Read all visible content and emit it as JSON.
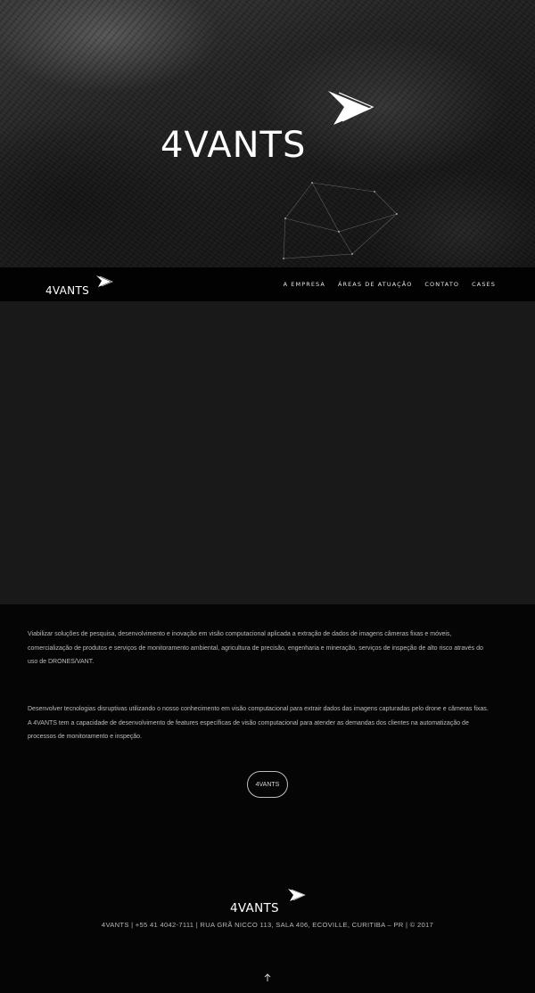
{
  "hero": {
    "logo_text": "4VANTS",
    "background": "aerial dark rocky terrain"
  },
  "navbar": {
    "logo_text": "4VANTS",
    "menu": [
      {
        "label": "A EMPRESA"
      },
      {
        "label": "ÁREAS DE ATUAÇÃO"
      },
      {
        "label": "CONTATO"
      },
      {
        "label": "CASES"
      }
    ]
  },
  "content": {
    "paragraph_1": "Viabilizar soluções de pesquisa, desenvolvimento e inovação em visão computacional aplicada a extração de dados de imagens câmeras fixas e móveis, comercialização de produtos e serviços de monitoramento ambiental, agricultura de precisão, engenharia e mineração, serviços de inspeção de alto risco através do uso de DRONES/VANT.",
    "paragraph_2": "Desenvolver tecnologias disruptivas utilizando o nosso conhecimento em visão computacional para extrair dados das imagens capturadas pelo drone e câmeras fixas. A 4VANTS tem a capacidade de desenvolvimento de features específicas de visão computacional para atender as demandas dos clientes na automatização de processos de monitoramento e inspeção.",
    "cta_label": "4VANTS"
  },
  "footer": {
    "logo_text": "4VANTS",
    "info": "4VANTS | +55 41 4042-7111 | RUA GRÃ NICCO 113, SALA 406, ECOVILLE, CURITIBA – PR | © 2017",
    "back_to_top_icon": "arrow-up-icon"
  },
  "colors": {
    "background": "#050505",
    "band": "#19191a",
    "navbar": "#020202",
    "text": "#bdbdbd",
    "logo": "#ffffff"
  }
}
